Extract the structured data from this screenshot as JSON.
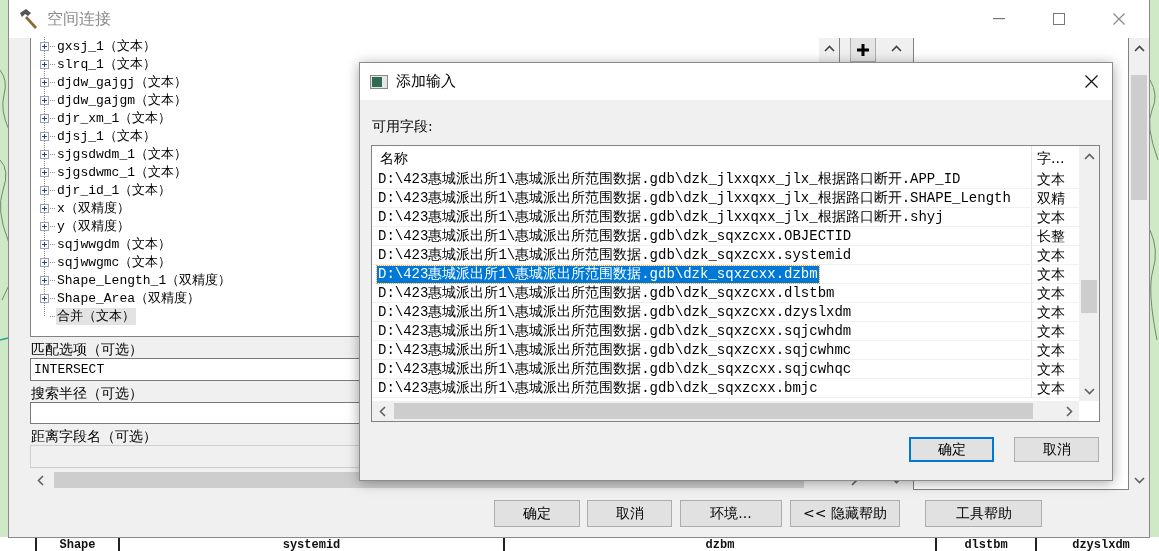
{
  "background_table": {
    "columns": [
      "Shape",
      "systemid",
      "dzbm",
      "dlstbm",
      "dzyslxdm"
    ]
  },
  "window": {
    "title": "空间连接",
    "field_tree": [
      {
        "label": "gxsj_1（文本）",
        "kind": "group",
        "selected": false
      },
      {
        "label": "slrq_1（文本）",
        "kind": "group",
        "selected": false
      },
      {
        "label": "djdw_gajgj（文本）",
        "kind": "group",
        "selected": false
      },
      {
        "label": "djdw_gajgm（文本）",
        "kind": "group",
        "selected": false
      },
      {
        "label": "djr_xm_1（文本）",
        "kind": "group",
        "selected": false
      },
      {
        "label": "djsj_1（文本）",
        "kind": "group",
        "selected": false
      },
      {
        "label": "sjgsdwdm_1（文本）",
        "kind": "group",
        "selected": false
      },
      {
        "label": "sjgsdwmc_1（文本）",
        "kind": "group",
        "selected": false
      },
      {
        "label": "djr_id_1（文本）",
        "kind": "group",
        "selected": false
      },
      {
        "label": "x（双精度）",
        "kind": "group",
        "selected": false
      },
      {
        "label": "y（双精度）",
        "kind": "group",
        "selected": false
      },
      {
        "label": "sqjwwgdm（文本）",
        "kind": "group",
        "selected": false
      },
      {
        "label": "sqjwwgmc（文本）",
        "kind": "group",
        "selected": false
      },
      {
        "label": "Shape_Length_1（双精度）",
        "kind": "group",
        "selected": false
      },
      {
        "label": "Shape_Area（双精度）",
        "kind": "group",
        "selected": false
      },
      {
        "label": "合并（文本）",
        "kind": "leaf",
        "selected": true
      }
    ],
    "match_option": {
      "label": "匹配选项（可选）",
      "value": "INTERSECT"
    },
    "search_radius": {
      "label": "搜索半径（可选）"
    },
    "distance_field": {
      "label": "距离字段名（可选）",
      "disabled": true
    },
    "buttons": [
      "确定",
      "取消",
      "环境...",
      "<< 隐藏帮助",
      "工具帮助"
    ]
  },
  "dialog": {
    "title": "添加输入",
    "list_label": "可用字段:",
    "columns": [
      "名称",
      "字..."
    ],
    "rows": [
      {
        "name": "D:\\423惠城派出所1\\惠城派出所范围数据.gdb\\dzk_jlxxqxx_jlx_根据路口断开.APP_ID",
        "type": "文本",
        "selected": false
      },
      {
        "name": "D:\\423惠城派出所1\\惠城派出所范围数据.gdb\\dzk_jlxxqxx_jlx_根据路口断开.SHAPE_Length",
        "type": "双精",
        "selected": false
      },
      {
        "name": "D:\\423惠城派出所1\\惠城派出所范围数据.gdb\\dzk_jlxxqxx_jlx_根据路口断开.shyj",
        "type": "文本",
        "selected": false
      },
      {
        "name": "D:\\423惠城派出所1\\惠城派出所范围数据.gdb\\dzk_sqxzcxx.OBJECTID",
        "type": "长整",
        "selected": false
      },
      {
        "name": "D:\\423惠城派出所1\\惠城派出所范围数据.gdb\\dzk_sqxzcxx.systemid",
        "type": "文本",
        "selected": false
      },
      {
        "name": "D:\\423惠城派出所1\\惠城派出所范围数据.gdb\\dzk_sqxzcxx.dzbm",
        "type": "文本",
        "selected": true
      },
      {
        "name": "D:\\423惠城派出所1\\惠城派出所范围数据.gdb\\dzk_sqxzcxx.dlstbm",
        "type": "文本",
        "selected": false
      },
      {
        "name": "D:\\423惠城派出所1\\惠城派出所范围数据.gdb\\dzk_sqxzcxx.dzyslxdm",
        "type": "文本",
        "selected": false
      },
      {
        "name": "D:\\423惠城派出所1\\惠城派出所范围数据.gdb\\dzk_sqxzcxx.sqjcwhdm",
        "type": "文本",
        "selected": false
      },
      {
        "name": "D:\\423惠城派出所1\\惠城派出所范围数据.gdb\\dzk_sqxzcxx.sqjcwhmc",
        "type": "文本",
        "selected": false
      },
      {
        "name": "D:\\423惠城派出所1\\惠城派出所范围数据.gdb\\dzk_sqxzcxx.sqjcwhqc",
        "type": "文本",
        "selected": false
      },
      {
        "name": "D:\\423惠城派出所1\\惠城派出所范围数据.gdb\\dzk_sqxzcxx.bmjc",
        "type": "文本",
        "selected": false
      }
    ],
    "buttons": [
      {
        "label": "确定",
        "focused": true
      },
      {
        "label": "取消",
        "focused": false
      }
    ]
  }
}
